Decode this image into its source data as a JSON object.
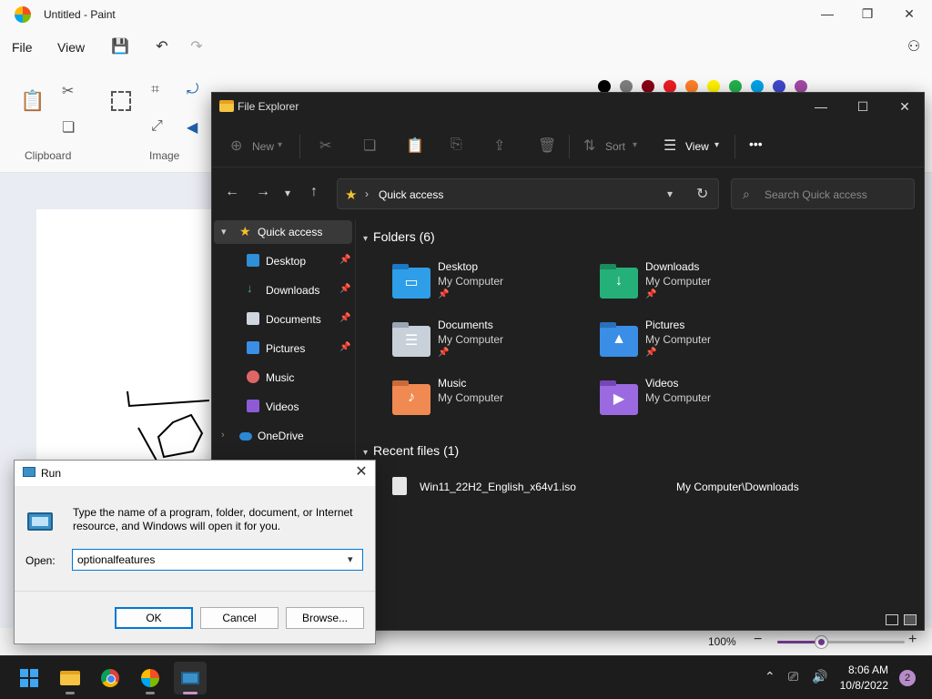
{
  "paint": {
    "title": "Untitled - Paint",
    "menu": {
      "file": "File",
      "view": "View"
    },
    "groups": {
      "clipboard": "Clipboard",
      "image": "Image"
    },
    "colors": [
      "#000000",
      "#7f7f7f",
      "#880015",
      "#ed1c24",
      "#ff7f27",
      "#fff200",
      "#22b14c",
      "#00a2e8",
      "#3f48cc",
      "#a349a4"
    ],
    "zoom": {
      "label": "100%",
      "minus": "−",
      "plus": "+",
      "level": 0.36
    }
  },
  "explorer": {
    "title": "File Explorer",
    "toolbar": {
      "new": "New",
      "sort": "Sort",
      "view": "View",
      "more": "•••"
    },
    "address": {
      "path": "Quick access"
    },
    "search": {
      "placeholder": "Search Quick access"
    },
    "nav": {
      "quick_access": "Quick access",
      "items": [
        {
          "label": "Desktop",
          "pinned": true
        },
        {
          "label": "Downloads",
          "pinned": true
        },
        {
          "label": "Documents",
          "pinned": true
        },
        {
          "label": "Pictures",
          "pinned": true
        },
        {
          "label": "Music",
          "pinned": false
        },
        {
          "label": "Videos",
          "pinned": false
        }
      ],
      "onedrive": "OneDrive"
    },
    "folders_header": "Folders (6)",
    "folders": [
      {
        "name": "Desktop",
        "location": "My Computer",
        "pinned": true
      },
      {
        "name": "Downloads",
        "location": "My Computer",
        "pinned": true
      },
      {
        "name": "Documents",
        "location": "My Computer",
        "pinned": true
      },
      {
        "name": "Pictures",
        "location": "My Computer",
        "pinned": true
      },
      {
        "name": "Music",
        "location": "My Computer",
        "pinned": false
      },
      {
        "name": "Videos",
        "location": "My Computer",
        "pinned": false
      }
    ],
    "recent_header": "Recent files (1)",
    "recent": [
      {
        "name": "Win11_22H2_English_x64v1.iso",
        "path": "My Computer\\Downloads"
      }
    ]
  },
  "run": {
    "title": "Run",
    "description": "Type the name of a program, folder, document, or Internet resource, and Windows will open it for you.",
    "open_label": "Open:",
    "input_value": "optionalfeatures",
    "buttons": {
      "ok": "OK",
      "cancel": "Cancel",
      "browse": "Browse..."
    }
  },
  "taskbar": {
    "time": "8:06 AM",
    "date": "10/8/2022",
    "notifications": "2"
  }
}
